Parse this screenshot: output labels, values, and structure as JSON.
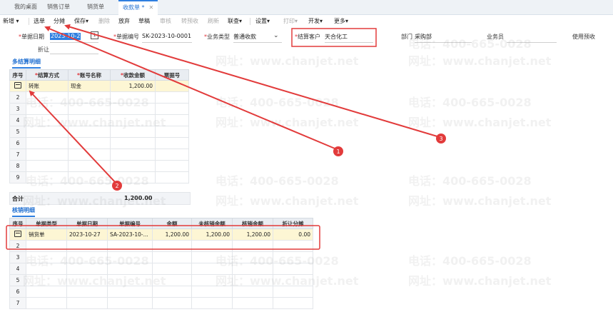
{
  "tabs": [
    {
      "label": "我的桌面"
    },
    {
      "label": "销售订单"
    },
    {
      "label": "销货单"
    },
    {
      "label": "收款单 *"
    }
  ],
  "toolbar": {
    "new": "新增",
    "select": "选单",
    "split": "分摊",
    "save": "保存",
    "delete": "删除",
    "abandon": "放弃",
    "draft": "草稿",
    "approve": "审核",
    "transfer": "转预收",
    "refresh": "刷新",
    "link_query": "联查",
    "settings": "设置",
    "print": "打印",
    "develop": "开发",
    "more": "更多"
  },
  "header": {
    "date_label": "单据日期",
    "date_value": "2023-10-2",
    "doc_no_label": "单据编号",
    "doc_no_value": "SK-2023-10-0001",
    "biz_type_label": "业务类型",
    "biz_type_value": "普通收款",
    "customer_label": "结算客户",
    "customer_value": "天合化工",
    "dept_label": "部门",
    "dept_value": "采购部",
    "salesman_label": "业务员",
    "prepay_label": "使用预收",
    "discount_label": "折让"
  },
  "settlement": {
    "title": "多结算明细",
    "columns": [
      "序号",
      "结算方式",
      "账号名称",
      "收款金额",
      "票据号"
    ],
    "rows": [
      {
        "method": "转账",
        "account": "现金",
        "amount": "1,200.00",
        "bill": ""
      }
    ],
    "total_label": "合计",
    "total_value": "1,200.00"
  },
  "writeoff": {
    "title": "核销明细",
    "columns": [
      "序号",
      "单据类型",
      "单据日期",
      "单据编号",
      "金额",
      "未核销金额",
      "核销金额",
      "折让分摊"
    ],
    "rows": [
      {
        "type": "销货单",
        "date": "2023-10-27",
        "no": "SA-2023-10-...",
        "amount": "1,200.00",
        "unsettled": "1,200.00",
        "settled": "1,200.00",
        "discount": "0.00"
      }
    ]
  },
  "annotations": [
    "1",
    "2",
    "3"
  ],
  "watermark": {
    "phone": "电话：400-665-0028",
    "site": "网址：www.chanjet.net"
  },
  "colors": {
    "accent": "#2f7fe0",
    "annotation": "#e23b3b",
    "highlight_row": "#fdf6d4"
  }
}
